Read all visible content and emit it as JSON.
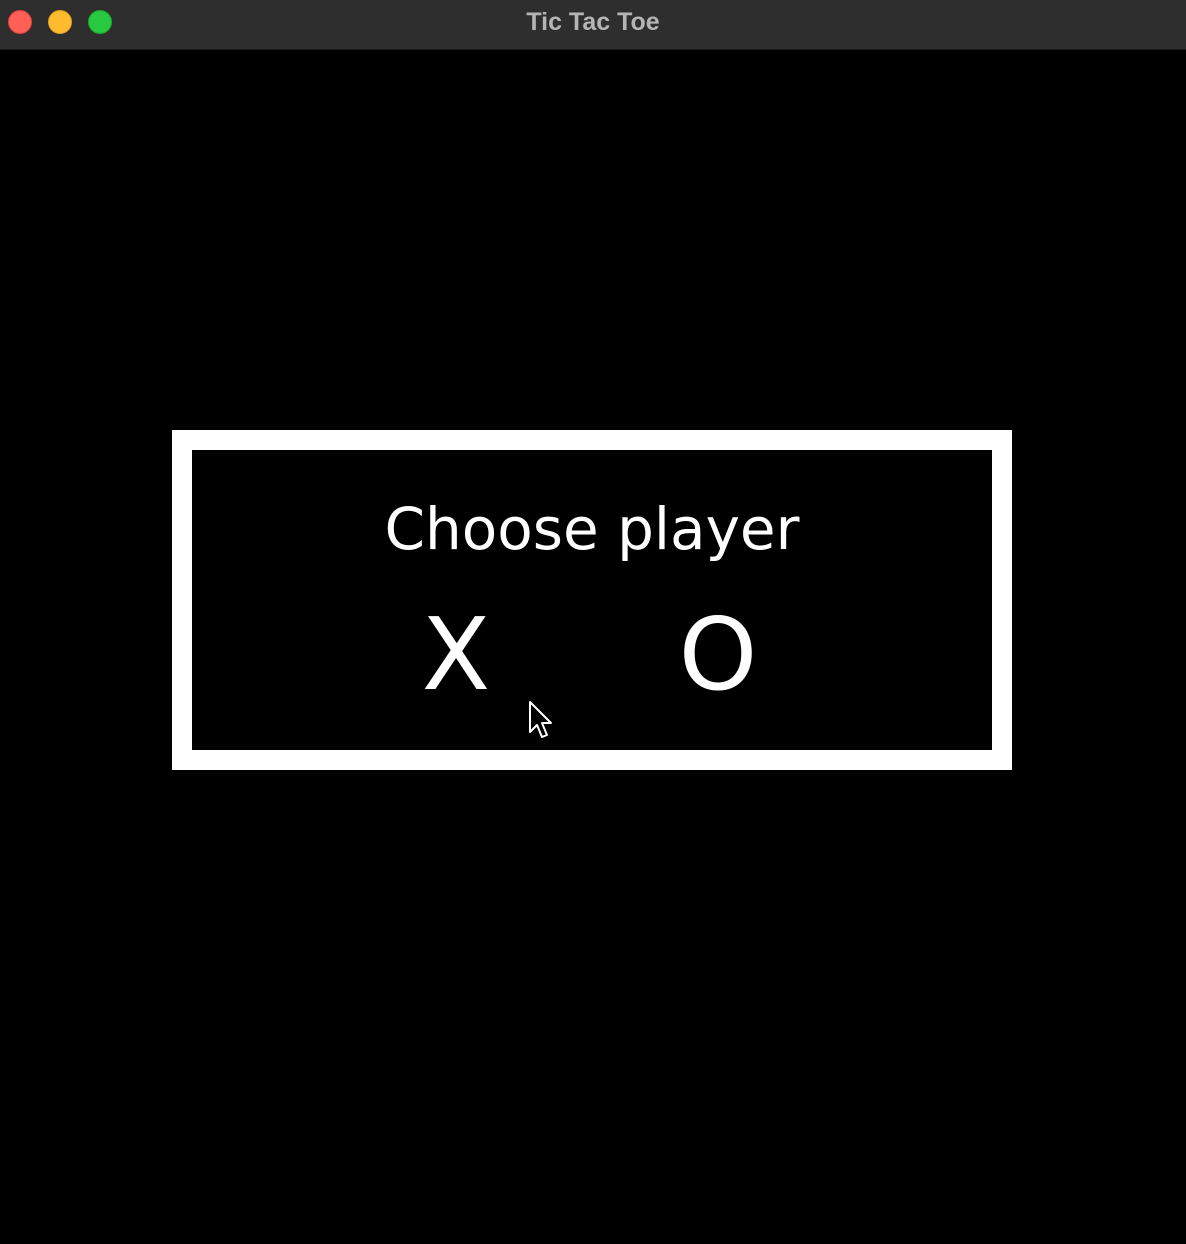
{
  "window": {
    "title": "Tic Tac Toe",
    "controls": [
      "close",
      "minimize",
      "zoom"
    ],
    "colors": {
      "close": "#fe5f57",
      "minimize": "#febc2e",
      "zoom": "#28c840"
    }
  },
  "dialog": {
    "prompt": "Choose player",
    "options": [
      {
        "label": "X"
      },
      {
        "label": "O"
      }
    ],
    "border_color": "#ffffff",
    "background_color": "#000000"
  },
  "cursor": {
    "icon": "arrow-pointer-icon"
  }
}
